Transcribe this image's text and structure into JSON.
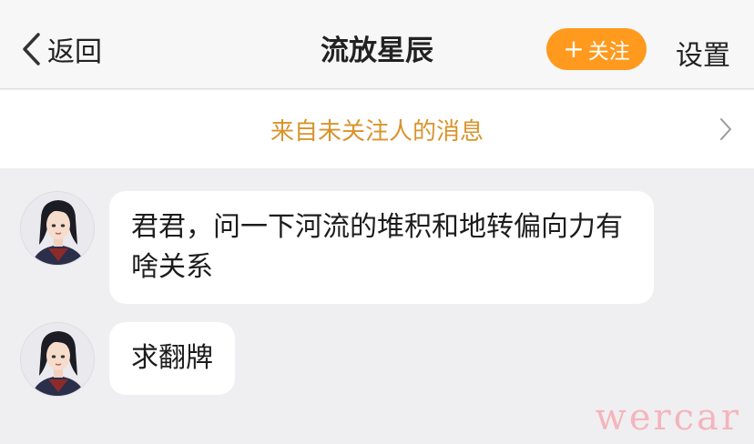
{
  "header": {
    "back_label": "返回",
    "title": "流放星辰",
    "follow_label": "关注",
    "follow_plus": "+",
    "settings_label": "设置"
  },
  "notice": {
    "text": "来自未关注人的消息"
  },
  "messages": [
    {
      "text": "君君，问一下河流的堆积和地转偏向力有啥关系"
    },
    {
      "text": "求翻牌"
    }
  ],
  "watermark": "wercar",
  "colors": {
    "accent": "#ff9a1e",
    "notice_text": "#d9932c",
    "background": "#efeff1"
  }
}
